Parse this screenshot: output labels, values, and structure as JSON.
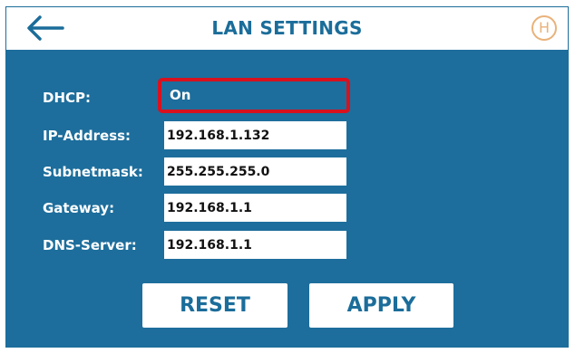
{
  "header": {
    "title": "LAN SETTINGS",
    "back_icon": "left-arrow-icon",
    "home_badge_letter": "H",
    "home_icon": "home-circle-icon"
  },
  "form": {
    "dhcp": {
      "label": "DHCP:",
      "value": "On"
    },
    "ip_address": {
      "label": "IP-Address:",
      "value": "192.168.1.132"
    },
    "subnet_mask": {
      "label": "Subnetmask:",
      "value": "255.255.255.0"
    },
    "gateway": {
      "label": "Gateway:",
      "value": "192.168.1.1"
    },
    "dns_server": {
      "label": "DNS-Server:",
      "value": "192.168.1.1"
    }
  },
  "buttons": {
    "reset": "RESET",
    "apply": "APPLY"
  },
  "colors": {
    "panel": "#1d6e9c",
    "accent": "#1b6d9a",
    "highlight": "#d8111f",
    "home_badge": "#e9b27a"
  }
}
